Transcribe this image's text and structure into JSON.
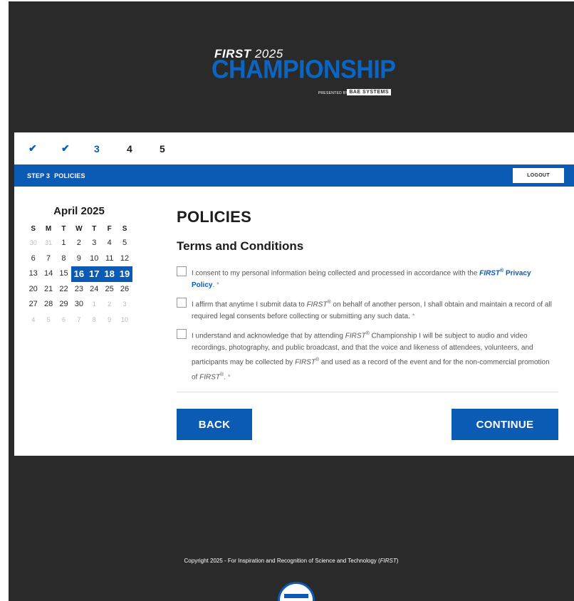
{
  "logo": {
    "first": "FIRST",
    "year": "2025",
    "championship": "CHAMPIONSHIP",
    "presented_by": "PRESENTED BY",
    "sponsor": "BAE SYSTEMS"
  },
  "stepper": {
    "steps": [
      {
        "label": "✔",
        "state": "done"
      },
      {
        "label": "✔",
        "state": "done"
      },
      {
        "label": "3",
        "state": "current"
      },
      {
        "label": "4",
        "state": "todo"
      },
      {
        "label": "5",
        "state": "todo"
      }
    ]
  },
  "stepbar": {
    "step": "STEP 3",
    "name": "POLICIES",
    "logout_label": "LOGOUT"
  },
  "calendar": {
    "title": "April 2025",
    "weekdays": [
      "S",
      "M",
      "T",
      "W",
      "T",
      "F",
      "S"
    ],
    "days": [
      {
        "d": "30",
        "t": "muted"
      },
      {
        "d": "31",
        "t": "muted"
      },
      {
        "d": "1",
        "t": ""
      },
      {
        "d": "2",
        "t": ""
      },
      {
        "d": "3",
        "t": ""
      },
      {
        "d": "4",
        "t": ""
      },
      {
        "d": "5",
        "t": ""
      },
      {
        "d": "6",
        "t": ""
      },
      {
        "d": "7",
        "t": ""
      },
      {
        "d": "8",
        "t": ""
      },
      {
        "d": "9",
        "t": ""
      },
      {
        "d": "10",
        "t": ""
      },
      {
        "d": "11",
        "t": ""
      },
      {
        "d": "12",
        "t": ""
      },
      {
        "d": "13",
        "t": ""
      },
      {
        "d": "14",
        "t": ""
      },
      {
        "d": "15",
        "t": ""
      },
      {
        "d": "16",
        "t": "sel"
      },
      {
        "d": "17",
        "t": "sel"
      },
      {
        "d": "18",
        "t": "sel"
      },
      {
        "d": "19",
        "t": "sel"
      },
      {
        "d": "20",
        "t": ""
      },
      {
        "d": "21",
        "t": ""
      },
      {
        "d": "22",
        "t": ""
      },
      {
        "d": "23",
        "t": ""
      },
      {
        "d": "24",
        "t": ""
      },
      {
        "d": "25",
        "t": ""
      },
      {
        "d": "26",
        "t": ""
      },
      {
        "d": "27",
        "t": ""
      },
      {
        "d": "28",
        "t": ""
      },
      {
        "d": "29",
        "t": ""
      },
      {
        "d": "30",
        "t": ""
      },
      {
        "d": "1",
        "t": "muted"
      },
      {
        "d": "2",
        "t": "muted"
      },
      {
        "d": "3",
        "t": "muted"
      },
      {
        "d": "4",
        "t": "muted"
      },
      {
        "d": "5",
        "t": "muted"
      },
      {
        "d": "6",
        "t": "muted"
      },
      {
        "d": "7",
        "t": "muted"
      },
      {
        "d": "8",
        "t": "muted"
      },
      {
        "d": "9",
        "t": "muted"
      },
      {
        "d": "10",
        "t": "muted"
      }
    ]
  },
  "main": {
    "title": "POLICIES",
    "section": "Terms and Conditions",
    "policies": {
      "consent": {
        "text1": "I consent to my personal information being collected and processed in accordance with the ",
        "brand": "FIRST",
        "link": "Privacy Policy",
        "tail": ".",
        "req": "*"
      },
      "affirm": {
        "text1": "I affirm that anytime I submit data to ",
        "brand": "FIRST",
        "text2": " on behalf of another person, I shall obtain and maintain a record of all required legal consents before collecting or submitting any such data.",
        "req": "*"
      },
      "media": {
        "text1": "I understand and acknowledge that by attending ",
        "brand": "FIRST",
        "text2": " Championship I will be subject to audio and video recordings, photography, and public broadcast, and that the voice and likeness of attendees, volunteers, and participants may be collected by ",
        "text3": " and used as a record of the event and for the non-commercial promotion of ",
        "tail": ".",
        "req": "*"
      }
    },
    "back_label": "BACK",
    "continue_label": "CONTINUE"
  },
  "footer": {
    "copyright": "Copyright 2025 - For Inspiration and Recognition of Science and Technology (",
    "brand": "FIRST",
    "close": ")"
  },
  "colors": {
    "brand_blue": "#0b5bb5",
    "background_dark": "#2a2a2a"
  }
}
